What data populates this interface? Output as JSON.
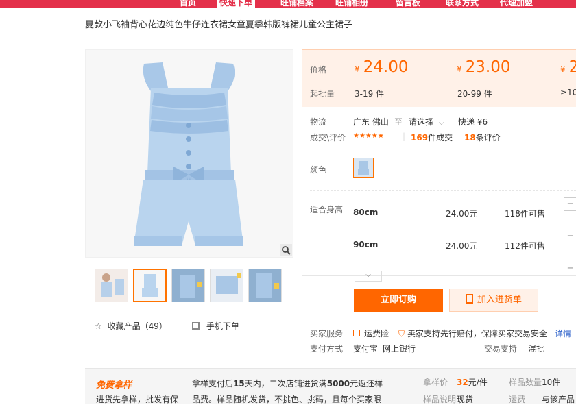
{
  "topnav": {
    "items": [
      "首页",
      "快速下单",
      "旺铺档案",
      "旺铺相册",
      "留言板",
      "联系方式",
      "代理加盟"
    ]
  },
  "product": {
    "title": "夏款小飞袖背心花边纯色牛仔连衣裙女童夏季韩版裤裙儿童公主裙子"
  },
  "gallery": {
    "favorite_label": "收藏产品（49）",
    "mobile_label": "手机下单"
  },
  "pricing": {
    "price_label": "价格",
    "moq_label": "起批量",
    "tiers": [
      {
        "currency": "¥",
        "price": "24.00",
        "range": "3-19 件"
      },
      {
        "currency": "¥",
        "price": "23.00",
        "range": "20-99 件"
      },
      {
        "currency": "¥",
        "price": "2",
        "range": "≥10"
      }
    ]
  },
  "logistics": {
    "label": "物流",
    "origin": "广东 佛山",
    "to": "至",
    "select": "请选择",
    "shipping": "快递 ¥6"
  },
  "deals": {
    "label": "成交\\评价",
    "stars": "★★★★★",
    "count_num": "169",
    "count_suffix": "件成交",
    "review_num": "18",
    "review_suffix": "条评价"
  },
  "color": {
    "label": "颜色"
  },
  "sizes": {
    "label": "适合身高",
    "rows": [
      {
        "size": "80cm",
        "price": "24.00元",
        "stock": "118件可售"
      },
      {
        "size": "90cm",
        "price": "24.00元",
        "stock": "112件可售"
      }
    ]
  },
  "actions": {
    "buy": "立即订购",
    "cart": "加入进货单"
  },
  "services": {
    "label": "买家服务",
    "item1": "运费险",
    "item2": "卖家支持先行赔付，保障买家交易安全",
    "detail": "详情",
    "pay_label": "支付方式",
    "pay1": "支付宝",
    "pay2": "网上银行",
    "trade_label": "交易支持",
    "trade_value": "混批"
  },
  "sample": {
    "badge": "免费拿样",
    "sub": "进货先拿样，批发有保",
    "desc1_a": "拿样支付后",
    "desc1_b": "15",
    "desc1_c": "天内，二次店铺进货满",
    "desc1_d": "5000",
    "desc1_e": "元返还样",
    "desc2": "品费。样品随机发货，不挑色、挑码，且每个买家限",
    "price_label": "拿样价",
    "price_value": "32",
    "price_unit": "元/件",
    "qty_label": "样品数量",
    "qty_value": "10件",
    "note_label": "样品说明",
    "note_value": "现货",
    "ship_label": "运费",
    "ship_value": "与该产品"
  },
  "colors": {
    "accent": "#ff6600",
    "nav": "#e4304a",
    "price_bg": "#fff1e8"
  }
}
